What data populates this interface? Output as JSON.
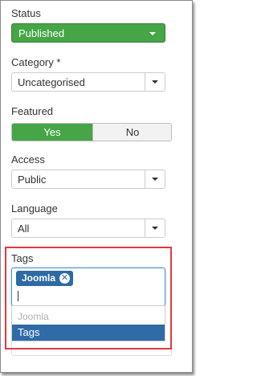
{
  "status": {
    "label": "Status",
    "value": "Published"
  },
  "category": {
    "label": "Category *",
    "value": "Uncategorised"
  },
  "featured": {
    "label": "Featured",
    "yes": "Yes",
    "no": "No",
    "selected": "Yes"
  },
  "access": {
    "label": "Access",
    "value": "Public"
  },
  "language": {
    "label": "Language",
    "value": "All"
  },
  "tags": {
    "label": "Tags",
    "selected": [
      "Joomla"
    ],
    "remove_icon": "✕",
    "dropdown": [
      {
        "label": "Joomla",
        "disabled": true
      },
      {
        "label": "Tags",
        "highlighted": true
      }
    ]
  },
  "colors": {
    "success": "#46a546",
    "primary": "#2f6ba6",
    "highlight_border": "#e2393d"
  }
}
